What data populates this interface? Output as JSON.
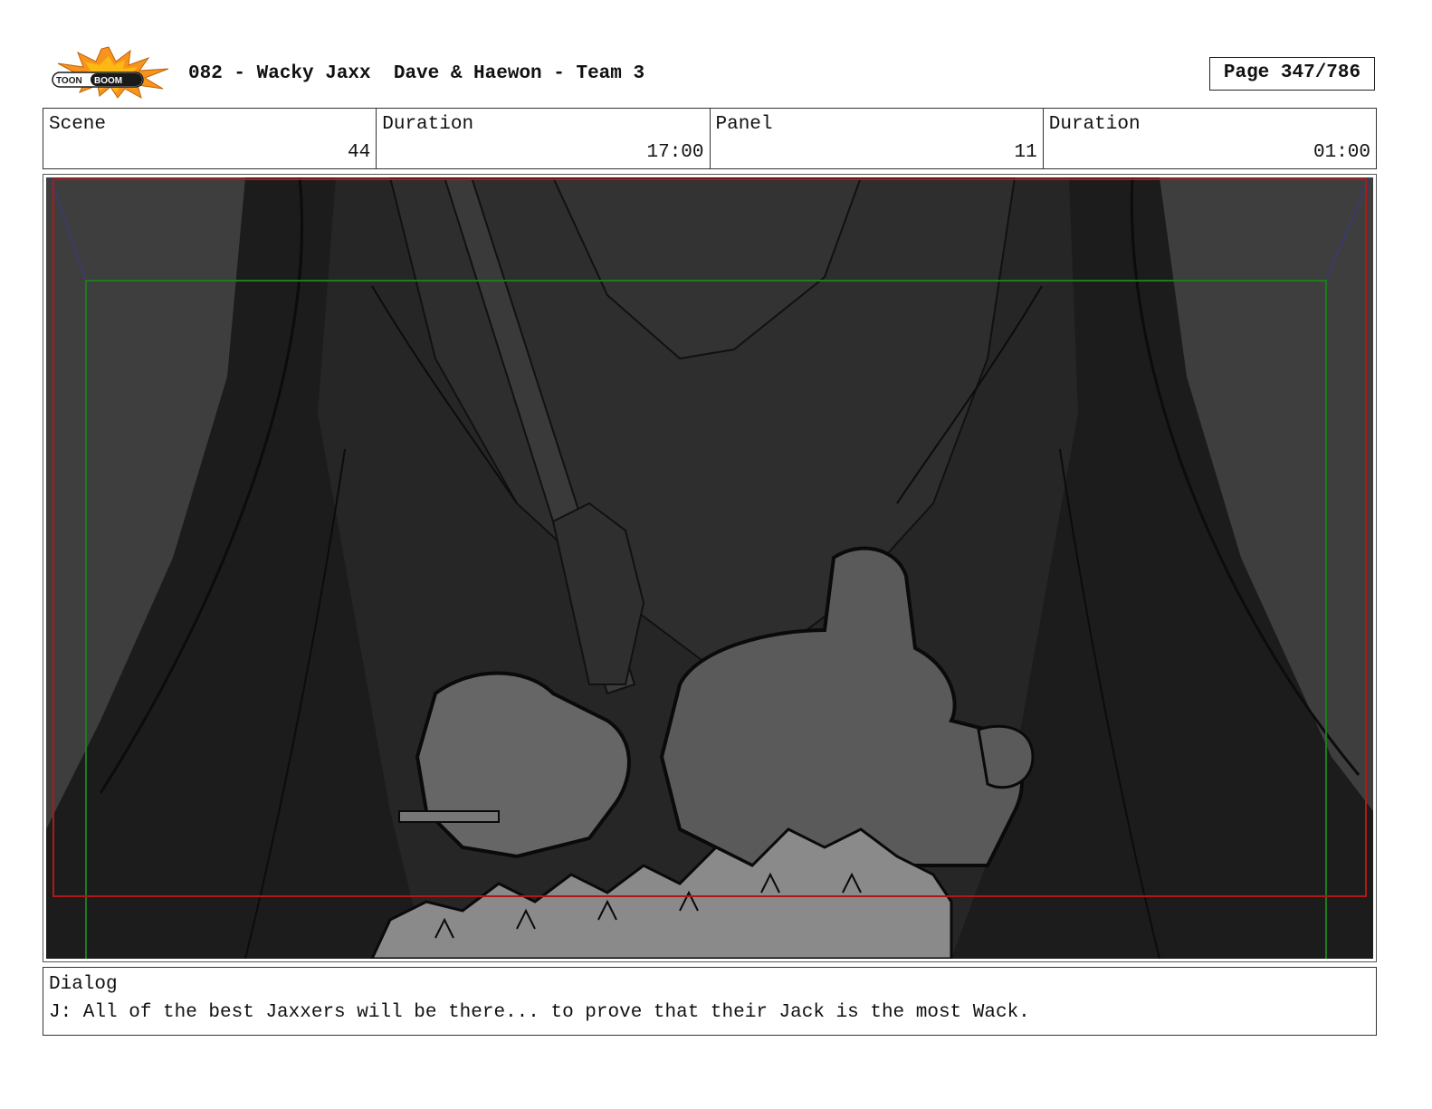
{
  "logo": {
    "text": "TOON BOOM",
    "icon": "toon-boom-logo-icon",
    "colors": {
      "burst": "#f7941d",
      "burst_inner": "#fdb913",
      "badge": "#1a1a1a"
    }
  },
  "header": {
    "title": "082 - Wacky Jaxx  Dave & Haewon - Team 3",
    "page": "Page 347/786"
  },
  "info": {
    "scene_label": "Scene",
    "scene_value": "44",
    "scene_duration_label": "Duration",
    "scene_duration_value": "17:00",
    "panel_label": "Panel",
    "panel_value": "11",
    "panel_duration_label": "Duration",
    "panel_duration_value": "01:00"
  },
  "panel": {
    "image": "storyboard-sketch-crowd-icon",
    "colors": {
      "background": "#3c3c3c",
      "dark": "#1e1e1e",
      "mid": "#2a2a2a",
      "figure": "#5a5a5a",
      "crowd": "#8a8a8a",
      "safe_frame": "#1f7a1f",
      "action_frame": "#b01818",
      "guide": "#3a3a7a"
    }
  },
  "dialog": {
    "label": "Dialog",
    "text": "J: All of the best Jaxxers will be there... to prove that their Jack is the most Wack."
  }
}
